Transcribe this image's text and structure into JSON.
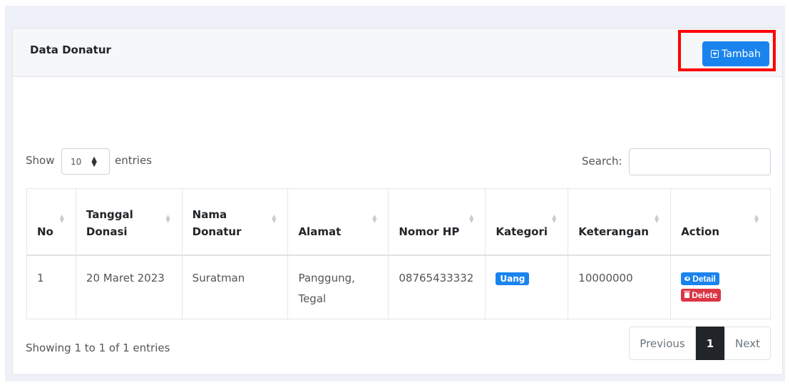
{
  "card": {
    "title": "Data Donatur",
    "add_button_label": "Tambah",
    "add_button_color": "#1a84ee"
  },
  "controls": {
    "show_label": "Show",
    "entries_value": "10",
    "entries_label": "entries",
    "search_label": "Search:",
    "search_value": ""
  },
  "table": {
    "columns": [
      "No",
      "Tanggal Donasi",
      "Nama Donatur",
      "Alamat",
      "Nomor HP",
      "Kategori",
      "Keterangan",
      "Action"
    ],
    "rows": [
      {
        "no": "1",
        "tanggal": "20 Maret 2023",
        "nama": "Suratman",
        "alamat": "Panggung, Tegal",
        "nomor_hp": "08765433332",
        "kategori": "Uang",
        "keterangan": "10000000",
        "action_detail": "Detail",
        "action_delete": "Delete"
      }
    ]
  },
  "footer": {
    "info": "Showing 1 to 1 of 1 entries",
    "previous": "Previous",
    "current_page": "1",
    "next": "Next"
  },
  "colors": {
    "primary": "#1a84ee",
    "danger": "#dc3545",
    "highlight": "#ff0000",
    "active_page": "#212529"
  }
}
